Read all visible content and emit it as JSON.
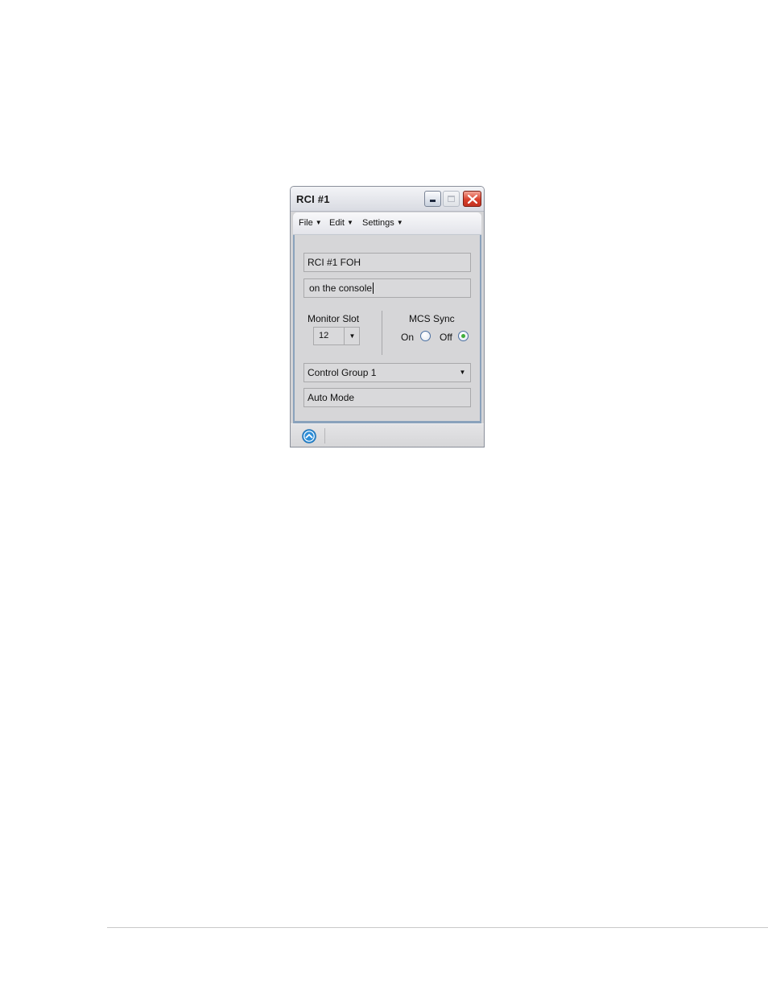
{
  "window": {
    "title": "RCI #1"
  },
  "menu": {
    "file": "File",
    "edit": "Edit",
    "settings": "Settings"
  },
  "fields": {
    "name_value": "RCI #1 FOH",
    "location_value": "on the console"
  },
  "monitor_slot": {
    "label": "Monitor Slot",
    "value": "12"
  },
  "mcs_sync": {
    "label": "MCS Sync",
    "on_label": "On",
    "off_label": "Off",
    "selected": "Off"
  },
  "control_group": {
    "value": "Control Group 1"
  },
  "mode": {
    "value": "Auto Mode"
  },
  "colors": {
    "close_button": "#d8402c",
    "panel_border": "#8aa2bc",
    "radio_selected": "#3fae3a",
    "status_icon": "#2f8fd8"
  },
  "icons": {
    "status": "chevron-up-circle-icon"
  }
}
